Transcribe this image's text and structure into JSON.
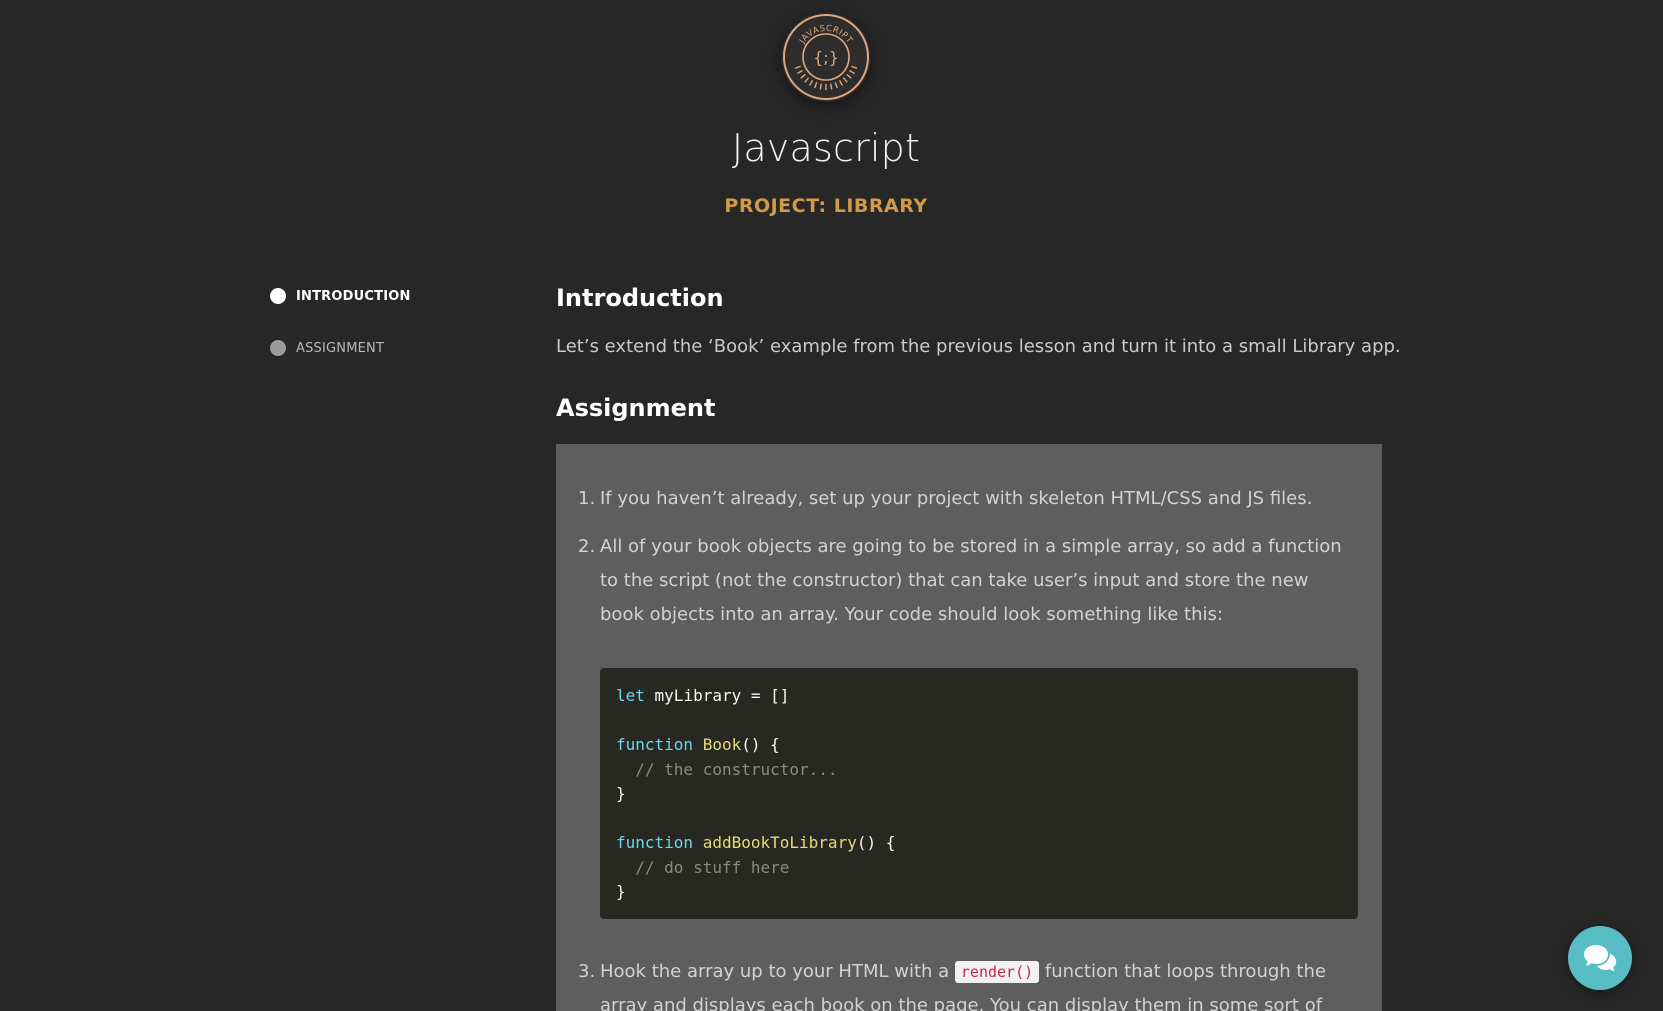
{
  "header": {
    "badge_text": "JAVASCRIPT",
    "badge_symbol": "{;}",
    "course_title": "Javascript",
    "project_title": "PROJECT: LIBRARY"
  },
  "sidebar": {
    "items": [
      {
        "label": "INTRODUCTION",
        "active": true
      },
      {
        "label": "ASSIGNMENT",
        "active": false
      }
    ]
  },
  "content": {
    "intro_heading": "Introduction",
    "intro_text": "Let’s extend the ‘Book’ example from the previous lesson and turn it into a small Library app.",
    "assignment_heading": "Assignment",
    "steps": [
      {
        "num": "1.",
        "text": "If you haven’t already, set up your project with skeleton HTML/CSS and JS files."
      },
      {
        "num": "2.",
        "text": "All of your book objects are going to be stored in a simple array, so add a function to the script (not the constructor) that can take user’s input and store the new book objects into an array. Your code should look something like this:"
      },
      {
        "num": "3.",
        "text_before": "Hook the array up to your HTML with a ",
        "code": "render()",
        "text_after": " function that loops through the array and displays each book on the page. You can display them in some sort of table, or each"
      }
    ],
    "code_lines": [
      [
        [
          "kw",
          "let"
        ],
        [
          "tx",
          " myLibrary = []"
        ]
      ],
      [],
      [
        [
          "kw",
          "function"
        ],
        [
          "tx",
          " "
        ],
        [
          "fn",
          "Book"
        ],
        [
          "tx",
          "() {"
        ]
      ],
      [
        [
          "cm",
          "  // the constructor..."
        ]
      ],
      [
        [
          "tx",
          "}"
        ]
      ],
      [],
      [
        [
          "kw",
          "function"
        ],
        [
          "tx",
          " "
        ],
        [
          "fn",
          "addBookToLibrary"
        ],
        [
          "tx",
          "() {"
        ]
      ],
      [
        [
          "cm",
          "  // do stuff here"
        ]
      ],
      [
        [
          "tx",
          "}"
        ]
      ]
    ]
  },
  "colors": {
    "page_bg": "#272727",
    "accent_gold": "#d29a45",
    "badge_ring": "#e0a57a",
    "assignment_bg": "#5e5e5e",
    "code_bg": "#272822",
    "chat_button": "#58bcc4"
  },
  "icons": {
    "badge": "javascript-course-badge",
    "chat": "chat-bubbles-icon"
  }
}
